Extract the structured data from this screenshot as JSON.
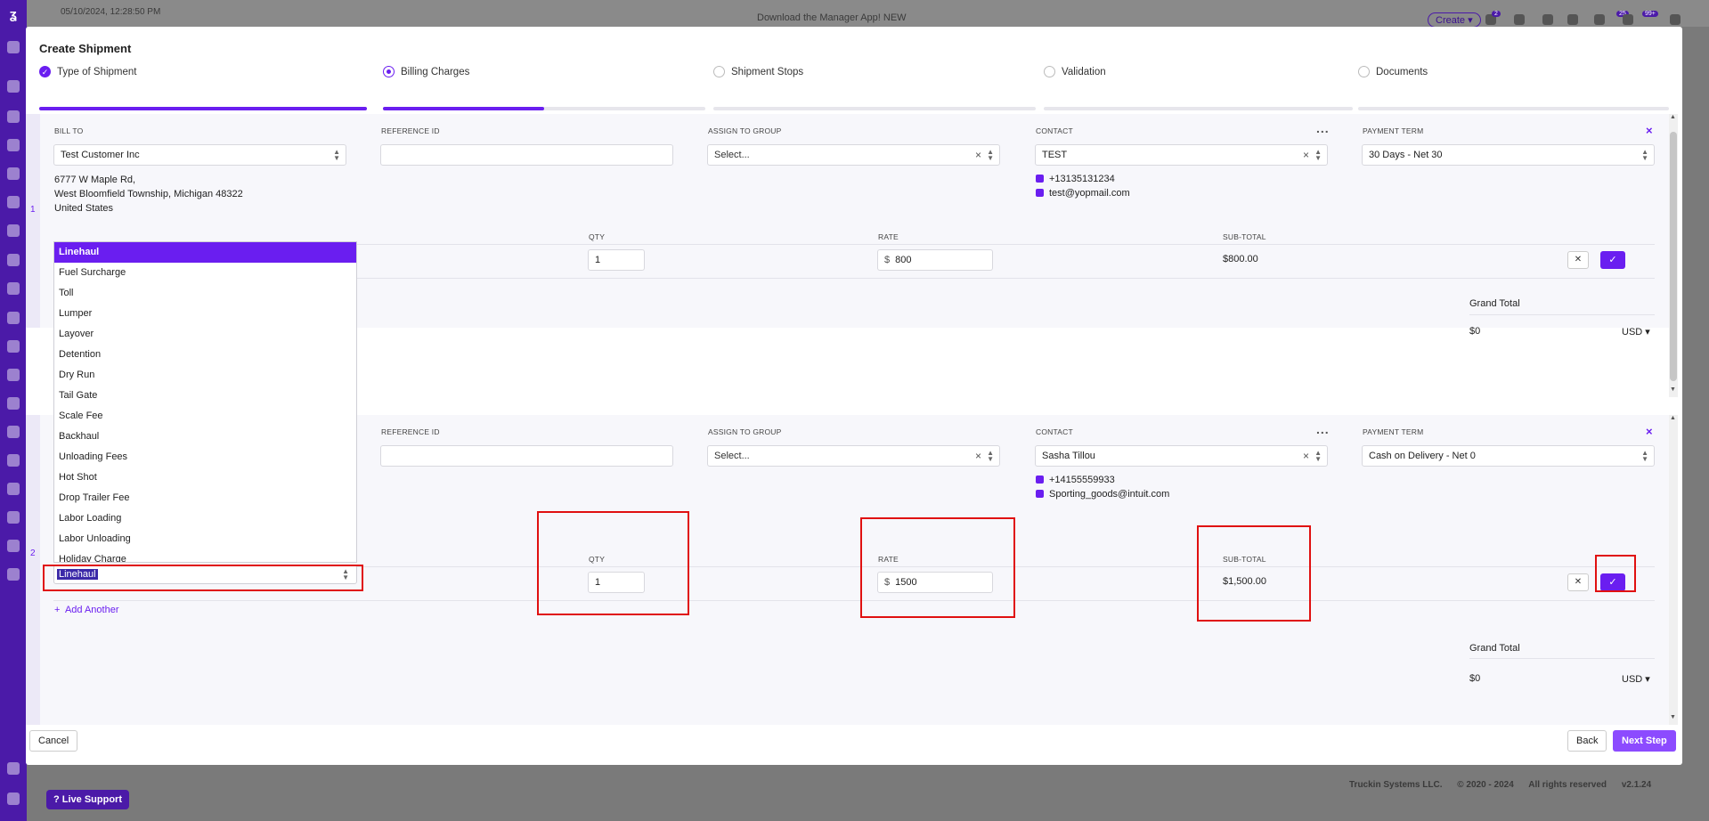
{
  "topbar": {
    "timestamp": "05/10/2024, 12:28:50 PM",
    "promo": "Download the Manager App! NEW",
    "create_label": "Create",
    "badges": [
      "2",
      "25",
      "99+"
    ]
  },
  "modal": {
    "title": "Create Shipment",
    "steps": [
      {
        "label": "Type of Shipment",
        "state": "done"
      },
      {
        "label": "Billing Charges",
        "state": "current"
      },
      {
        "label": "Shipment Stops",
        "state": "pending"
      },
      {
        "label": "Validation",
        "state": "pending"
      },
      {
        "label": "Documents",
        "state": "pending"
      }
    ],
    "current_step_progress": 0.5
  },
  "headers": {
    "bill_to": "BILL TO",
    "reference_id": "REFERENCE ID",
    "assign_to_group": "ASSIGN TO GROUP",
    "contact": "CONTACT",
    "payment_term": "PAYMENT TERM",
    "qty": "QTY",
    "rate": "RATE",
    "sub_total": "SUB-TOTAL",
    "grand_total": "Grand Total",
    "more": "...",
    "close": "×"
  },
  "bill1": {
    "number": "1",
    "bill_to": "Test Customer Inc",
    "address": "6777 W Maple Rd,\nWest Bloomfield Township, Michigan 48322\nUnited States",
    "reference_id": "",
    "group_placeholder": "Select...",
    "contact": "TEST",
    "phone": "+13135131234",
    "email": "test@yopmail.com",
    "payment_term": "30 Days - Net 30",
    "qty": "1",
    "rate_prefix": "$",
    "rate": "800",
    "sub_total": "$800.00",
    "grand_total": "$0",
    "currency": "USD"
  },
  "bill2": {
    "number": "2",
    "reference_id": "",
    "group_placeholder": "Select...",
    "contact": "Sasha Tillou",
    "phone": "+14155559933",
    "email": "Sporting_goods@intuit.com",
    "payment_term": "Cash on Delivery - Net 0",
    "charge": "Linehaul",
    "qty": "1",
    "rate_prefix": "$",
    "rate": "1500",
    "sub_total": "$1,500.00",
    "grand_total": "$0",
    "currency": "USD",
    "add_another": "Add Another"
  },
  "charge_options": [
    "Linehaul",
    "Fuel Surcharge",
    "Toll",
    "Lumper",
    "Layover",
    "Detention",
    "Dry Run",
    "Tail Gate",
    "Scale Fee",
    "Backhaul",
    "Unloading Fees",
    "Hot Shot",
    "Drop Trailer Fee",
    "Labor Loading",
    "Labor Unloading",
    "Holiday Charge"
  ],
  "footer": {
    "cancel": "Cancel",
    "back": "Back",
    "next": "Next Step",
    "company": "Truckin Systems LLC.",
    "copyright": "© 2020 - 2024",
    "rights": "All rights reserved",
    "version": "v2.1.24",
    "live_support": "Live Support"
  }
}
